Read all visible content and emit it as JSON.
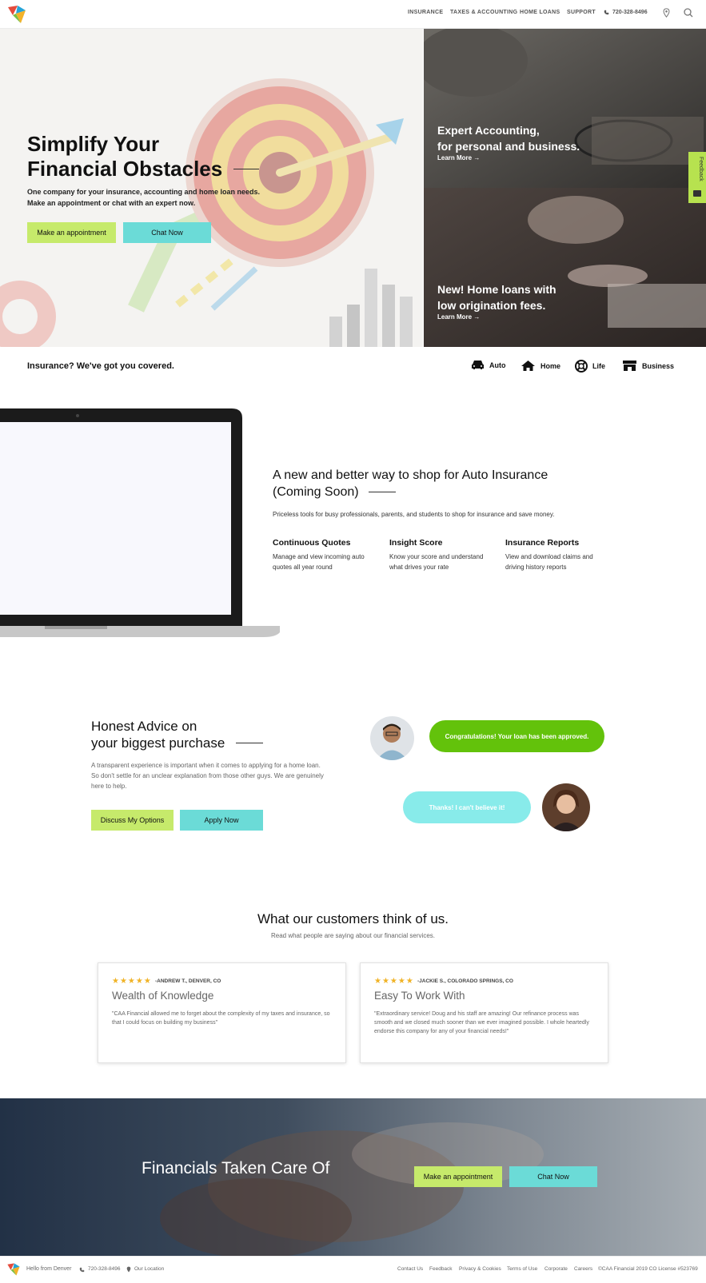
{
  "header": {
    "nav": [
      "INSURANCE",
      "TAXES & ACCOUNTING",
      "HOME LOANS",
      "SUPPORT"
    ],
    "phone": "720-328-8496"
  },
  "hero": {
    "title_line1": "Simplify Your",
    "title_line2": "Financial Obstacles",
    "sub_line1": "One company for your insurance, accounting and home loan needs.",
    "sub_line2": "Make an appointment or chat with an expert now.",
    "btn_appointment": "Make an appointment",
    "btn_chat": "Chat Now"
  },
  "promo_accounting": {
    "line1": "Expert Accounting,",
    "line2": "for personal and business.",
    "link": "Learn More →"
  },
  "promo_loans": {
    "line1": "New! Home loans with",
    "line2": "low origination fees.",
    "link": "Learn More →"
  },
  "feedback_tab": "Feedback",
  "insurance_bar": {
    "heading": "Insurance? We've got you covered.",
    "items": [
      {
        "label": "Auto",
        "icon": "car-icon"
      },
      {
        "label": "Home",
        "icon": "home-icon"
      },
      {
        "label": "Life",
        "icon": "lifebuoy-icon"
      },
      {
        "label": "Business",
        "icon": "store-icon"
      }
    ]
  },
  "auto_section": {
    "title_line1": "A new and better way to shop for Auto Insurance",
    "title_line2": "(Coming Soon)",
    "desc": "Priceless tools for busy professionals, parents, and students to shop for insurance and save money.",
    "features": [
      {
        "title": "Continuous Quotes",
        "line1": "Manage and view incoming auto",
        "line2": "quotes all year round"
      },
      {
        "title": "Insight Score",
        "line1": "Know your score and understand",
        "line2": "what drives your rate"
      },
      {
        "title": "Insurance Reports",
        "line1": "View and download claims and",
        "line2": "driving history reports"
      }
    ]
  },
  "advice": {
    "title_line1": "Honest Advice on",
    "title_line2": "your biggest purchase",
    "desc_line1": "A transparent experience is important when it comes to applying for a home loan.",
    "desc_line2": "So don't settle for an unclear explanation from those other guys. We are genuinely",
    "desc_line3": "here to help.",
    "btn_discuss": "Discuss My Options",
    "btn_apply": "Apply Now",
    "bubble_agent": "Congratulations! Your loan has been approved.",
    "bubble_customer": "Thanks! I can't believe it!"
  },
  "reviews": {
    "title": "What our customers think of us.",
    "subtitle": "Read what people are saying about our financial services.",
    "items": [
      {
        "stars": "★★★★★",
        "author": "-ANDREW T., DENVER, CO",
        "title": "Wealth of Knowledge",
        "body": "\"CAA Financial allowed me to forget about the complexity of my taxes and insurance, so that I could focus on building my business\""
      },
      {
        "stars": "★★★★★",
        "author": "-JACKIE S., COLORADO SPRINGS, CO",
        "title": "Easy To Work With",
        "body": "\"Extraordinary service! Doug and his staff are amazing! Our refinance process was smooth and we closed much sooner than we ever imagined possible. I whole heartedly endorse this company for any of your financial needs!\""
      }
    ]
  },
  "banner": {
    "title": "Financials Taken Care Of",
    "btn_appointment": "Make an appointment",
    "btn_chat": "Chat Now"
  },
  "footer": {
    "greeting": "Hello from Denver",
    "phone": "720-328-8496",
    "location": "Our Location",
    "links": [
      "Contact Us",
      "Feedback",
      "Privacy & Cookies",
      "Terms of Use",
      "Corporate",
      "Careers"
    ],
    "copyright": "©CAA Financial 2019 CO License #523769"
  },
  "colors": {
    "accent_green": "#c6ea6b",
    "accent_teal": "#6bdbd7",
    "bubble_green": "#63c20b",
    "bubble_teal": "#88ebea",
    "star": "#f0b326"
  }
}
